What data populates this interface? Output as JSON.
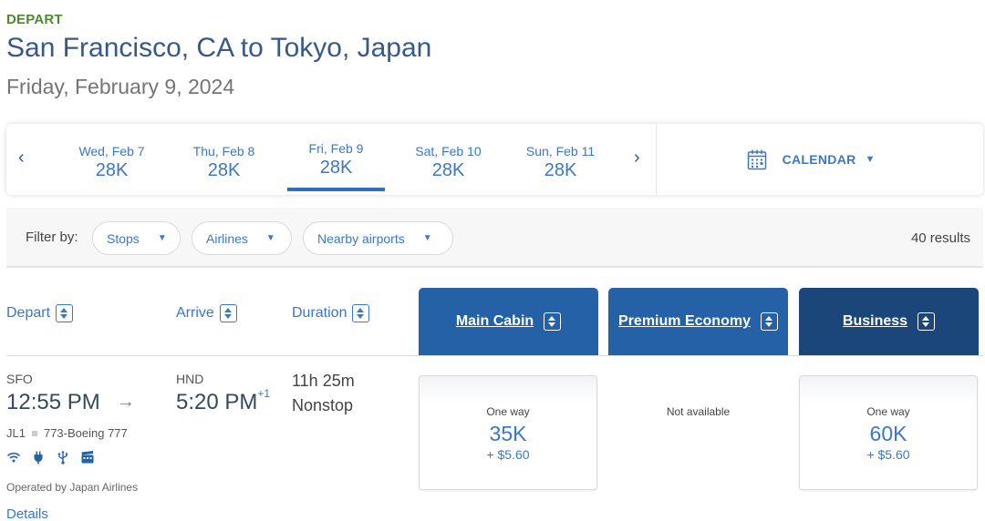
{
  "header": {
    "label": "DEPART",
    "route": "San Francisco, CA to Tokyo, Japan",
    "date": "Friday, February 9, 2024"
  },
  "date_carousel": {
    "prev_icon": "‹",
    "next_icon": "›",
    "dates": [
      {
        "day": "Wed, Feb 7",
        "price": "28K",
        "selected": false
      },
      {
        "day": "Thu, Feb 8",
        "price": "28K",
        "selected": false
      },
      {
        "day": "Fri, Feb 9",
        "price": "28K",
        "selected": true
      },
      {
        "day": "Sat, Feb 10",
        "price": "28K",
        "selected": false
      },
      {
        "day": "Sun, Feb 11",
        "price": "28K",
        "selected": false
      }
    ],
    "calendar_label": "CALENDAR",
    "caret": "▼"
  },
  "filters": {
    "label": "Filter by:",
    "chips": [
      "Stops",
      "Airlines",
      "Nearby airports"
    ],
    "caret": "▼",
    "results": "40 results"
  },
  "columns": {
    "depart": "Depart",
    "arrive": "Arrive",
    "duration": "Duration",
    "cabins": [
      "Main Cabin",
      "Premium Economy",
      "Business"
    ]
  },
  "accent_colors": {
    "depart_green": "#4a8b2c",
    "link_blue": "#3b78c3",
    "cabin_blue": "#2561a6",
    "business_navy": "#1b4679"
  },
  "flight": {
    "origin": "SFO",
    "depart_time": "12:55 PM",
    "arrow": "→",
    "destination": "HND",
    "arrive_time": "5:20 PM",
    "day_offset": "+1",
    "duration": "11h 25m",
    "stops": "Nonstop",
    "flight_number": "JL1",
    "aircraft": "773-Boeing 777",
    "amenities": [
      "wifi-icon",
      "power-outlet-icon",
      "usb-icon",
      "entertainment-icon"
    ],
    "operated_by": "Operated by Japan Airlines",
    "details_link": "Details",
    "fares": {
      "main_cabin": {
        "label": "One way",
        "miles": "35K",
        "tax": "+ $5.60"
      },
      "premium_economy": {
        "label": "Not available"
      },
      "business": {
        "label": "One way",
        "miles": "60K",
        "tax": "+ $5.60"
      }
    }
  }
}
